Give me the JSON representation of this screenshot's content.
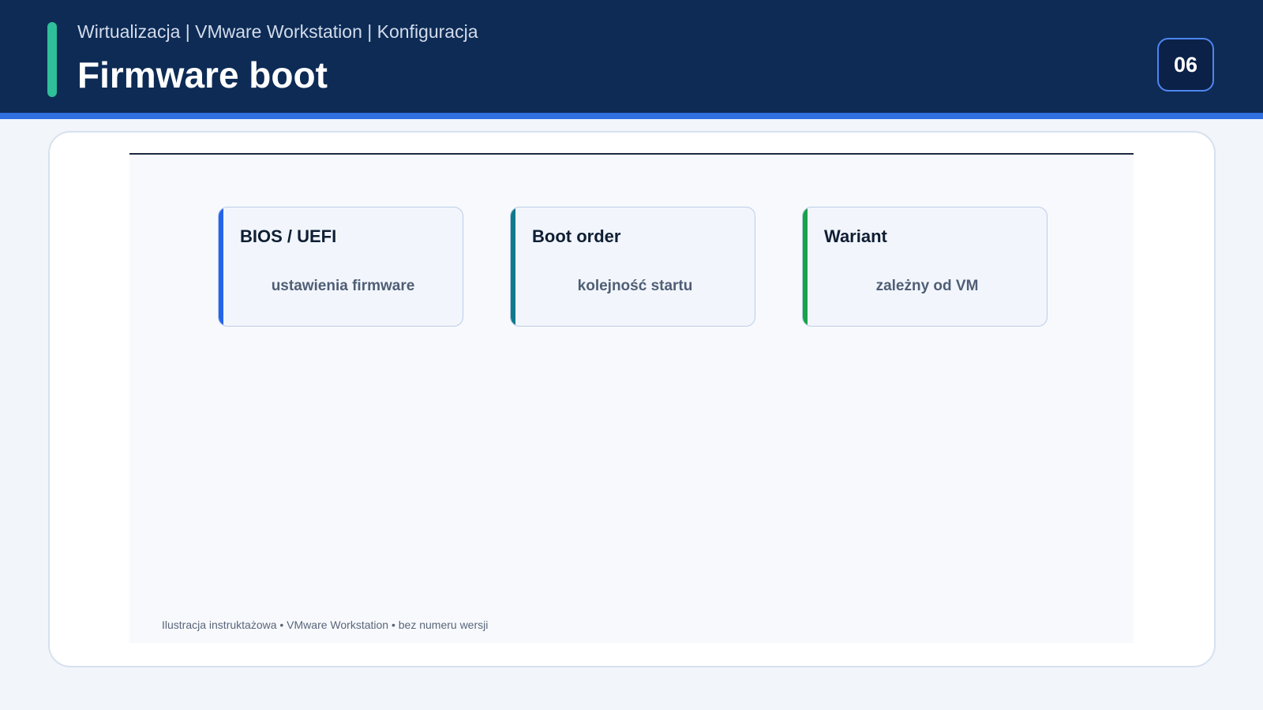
{
  "header": {
    "breadcrumb": "Wirtualizacja | VMware Workstation | Konfiguracja",
    "title": "Firmware boot",
    "slide_number": "06"
  },
  "cards": [
    {
      "title": "BIOS / UEFI",
      "value": "ustawienia firmware",
      "accent": "#2563eb"
    },
    {
      "title": "Boot order",
      "value": "kolejność startu",
      "accent": "#0f7a8c"
    },
    {
      "title": "Wariant",
      "value": "zależny od VM",
      "accent": "#16a34a"
    }
  ],
  "footnote": "Ilustracja instruktażowa • VMware Workstation • bez numeru wersji",
  "colors": {
    "header_bg": "#0d2b55",
    "header_accent": "#2f6fe0",
    "marker": "#2fbf9a"
  }
}
